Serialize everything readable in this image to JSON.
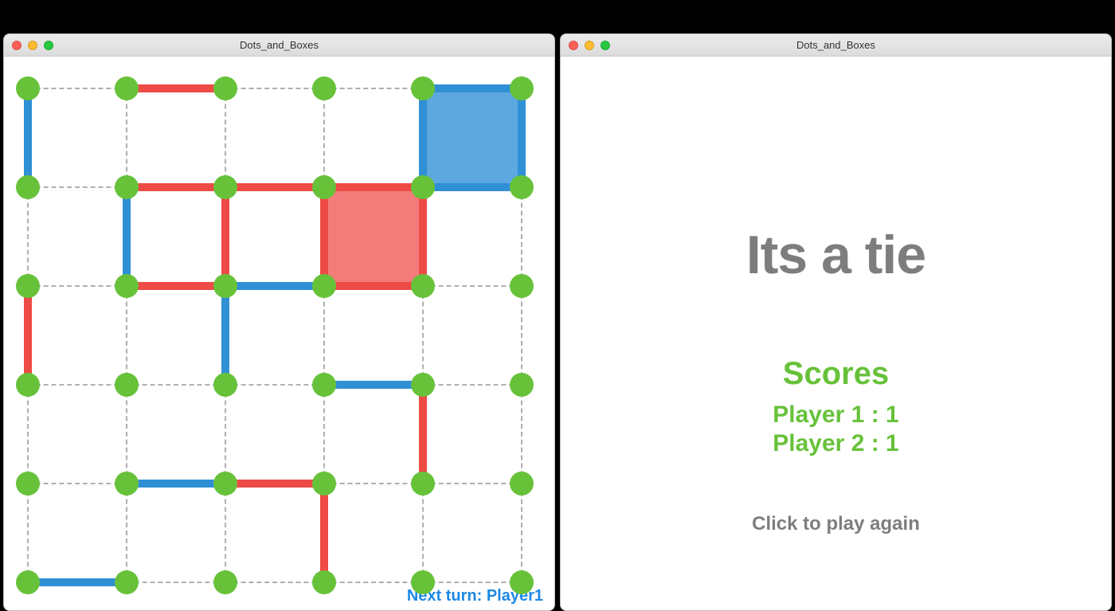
{
  "windows": {
    "game": {
      "title": "Dots_and_Boxes"
    },
    "result": {
      "title": "Dots_and_Boxes"
    }
  },
  "colors": {
    "dot": "#67c23a",
    "p1_line": "#2f90d6",
    "p2_line": "#ee4a46",
    "p1_fill": "rgba(47,144,214,0.78)",
    "p2_fill": "rgba(238,74,70,0.72)",
    "grid_dash": "#b0b0b0",
    "status_text": "#1e88e5",
    "score_text": "#67c23a",
    "muted_text": "#7d7d7d"
  },
  "game": {
    "grid": {
      "rows": 6,
      "cols": 6
    },
    "players": {
      "p1": "Player1",
      "p2": "Player2"
    },
    "next_turn_label": "Next turn: Player1",
    "horizontal_edges": [
      [
        {
          "owner": null
        },
        {
          "owner": "p2"
        },
        {
          "owner": null
        },
        {
          "owner": null
        },
        {
          "owner": "p1"
        }
      ],
      [
        {
          "owner": null
        },
        {
          "owner": "p2"
        },
        {
          "owner": "p2"
        },
        {
          "owner": "p2"
        },
        {
          "owner": "p1"
        }
      ],
      [
        {
          "owner": null
        },
        {
          "owner": "p2"
        },
        {
          "owner": "p1"
        },
        {
          "owner": "p2"
        },
        {
          "owner": null
        }
      ],
      [
        {
          "owner": null
        },
        {
          "owner": null
        },
        {
          "owner": null
        },
        {
          "owner": "p1"
        },
        {
          "owner": null
        }
      ],
      [
        {
          "owner": null
        },
        {
          "owner": "p1"
        },
        {
          "owner": "p2"
        },
        {
          "owner": null
        },
        {
          "owner": null
        }
      ],
      [
        {
          "owner": "p1"
        },
        {
          "owner": null
        },
        {
          "owner": null
        },
        {
          "owner": null
        },
        {
          "owner": null
        }
      ]
    ],
    "vertical_edges": [
      [
        {
          "owner": "p1"
        },
        {
          "owner": null
        },
        {
          "owner": null
        },
        {
          "owner": null
        },
        {
          "owner": "p1"
        },
        {
          "owner": "p1"
        }
      ],
      [
        {
          "owner": null
        },
        {
          "owner": "p1"
        },
        {
          "owner": "p2"
        },
        {
          "owner": "p2"
        },
        {
          "owner": "p2"
        },
        {
          "owner": null
        }
      ],
      [
        {
          "owner": "p2"
        },
        {
          "owner": null
        },
        {
          "owner": "p1"
        },
        {
          "owner": null
        },
        {
          "owner": null
        },
        {
          "owner": null
        }
      ],
      [
        {
          "owner": null
        },
        {
          "owner": null
        },
        {
          "owner": null
        },
        {
          "owner": null
        },
        {
          "owner": "p2"
        },
        {
          "owner": null
        }
      ],
      [
        {
          "owner": null
        },
        {
          "owner": null
        },
        {
          "owner": null
        },
        {
          "owner": "p2"
        },
        {
          "owner": null
        },
        {
          "owner": null
        }
      ]
    ],
    "boxes": [
      {
        "row": 0,
        "col": 4,
        "owner": "p1"
      },
      {
        "row": 1,
        "col": 3,
        "owner": "p2"
      }
    ]
  },
  "result": {
    "headline": "Its a tie",
    "scores_label": "Scores",
    "p1_line": "Player 1 : 1",
    "p2_line": "Player 2 : 1",
    "p1_score": 1,
    "p2_score": 1,
    "play_again_label": "Click to play again"
  }
}
